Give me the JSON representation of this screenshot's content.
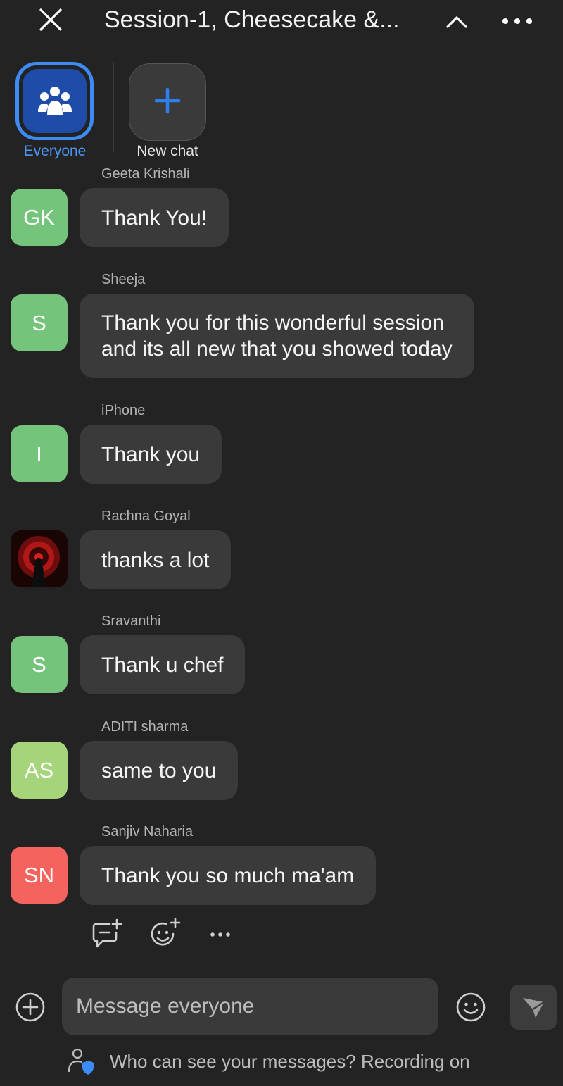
{
  "header": {
    "title": "Session-1, Cheesecake &...",
    "close_icon": "close-icon",
    "collapse_icon": "chevron-up-icon",
    "more_icon": "more-horizontal-icon"
  },
  "recipients": {
    "everyone_label": "Everyone",
    "everyone_icon": "group-icon",
    "new_chat_label": "New chat",
    "new_chat_icon": "plus-icon",
    "selected": "Everyone"
  },
  "messages": [
    {
      "sender": "Geeta Krishali",
      "initials": "GK",
      "avatar_color": "#75c47b",
      "text": "Thank You!"
    },
    {
      "sender": "Sheeja",
      "initials": "S",
      "avatar_color": "#75c47b",
      "text": "Thank you for this wonderful session\nand its all new that you showed today"
    },
    {
      "sender": "iPhone",
      "initials": "I",
      "avatar_color": "#75c47b",
      "text": "Thank you"
    },
    {
      "sender": "Rachna Goyal",
      "initials": "",
      "avatar_color": "#1a0505",
      "avatar_icon": "profile-photo",
      "text": "thanks a lot"
    },
    {
      "sender": "Sravanthi",
      "initials": "S",
      "avatar_color": "#75c47b",
      "text": "Thank u chef"
    },
    {
      "sender": "ADITI sharma",
      "initials": "AS",
      "avatar_color": "#a6d47a",
      "text": "same to you"
    },
    {
      "sender": "Sanjiv Naharia",
      "initials": "SN",
      "avatar_color": "#f5635f",
      "text": "Thank you so much ma'am"
    }
  ],
  "message_actions": {
    "reply_icon": "reply-icon",
    "react_icon": "add-reaction-icon",
    "more_icon": "more-horizontal-icon"
  },
  "composer": {
    "placeholder": "Message everyone",
    "value": "",
    "attach_icon": "add-circle-icon",
    "emoji_icon": "emoji-icon",
    "send_icon": "send-icon"
  },
  "footer": {
    "privacy_text": "Who can see your messages? Recording on",
    "privacy_icon": "user-shield-icon"
  },
  "colors": {
    "background": "#232323",
    "bubble": "#3a3a3a",
    "accent": "#3d8cf5",
    "plus_blue": "#2f7ef0"
  }
}
